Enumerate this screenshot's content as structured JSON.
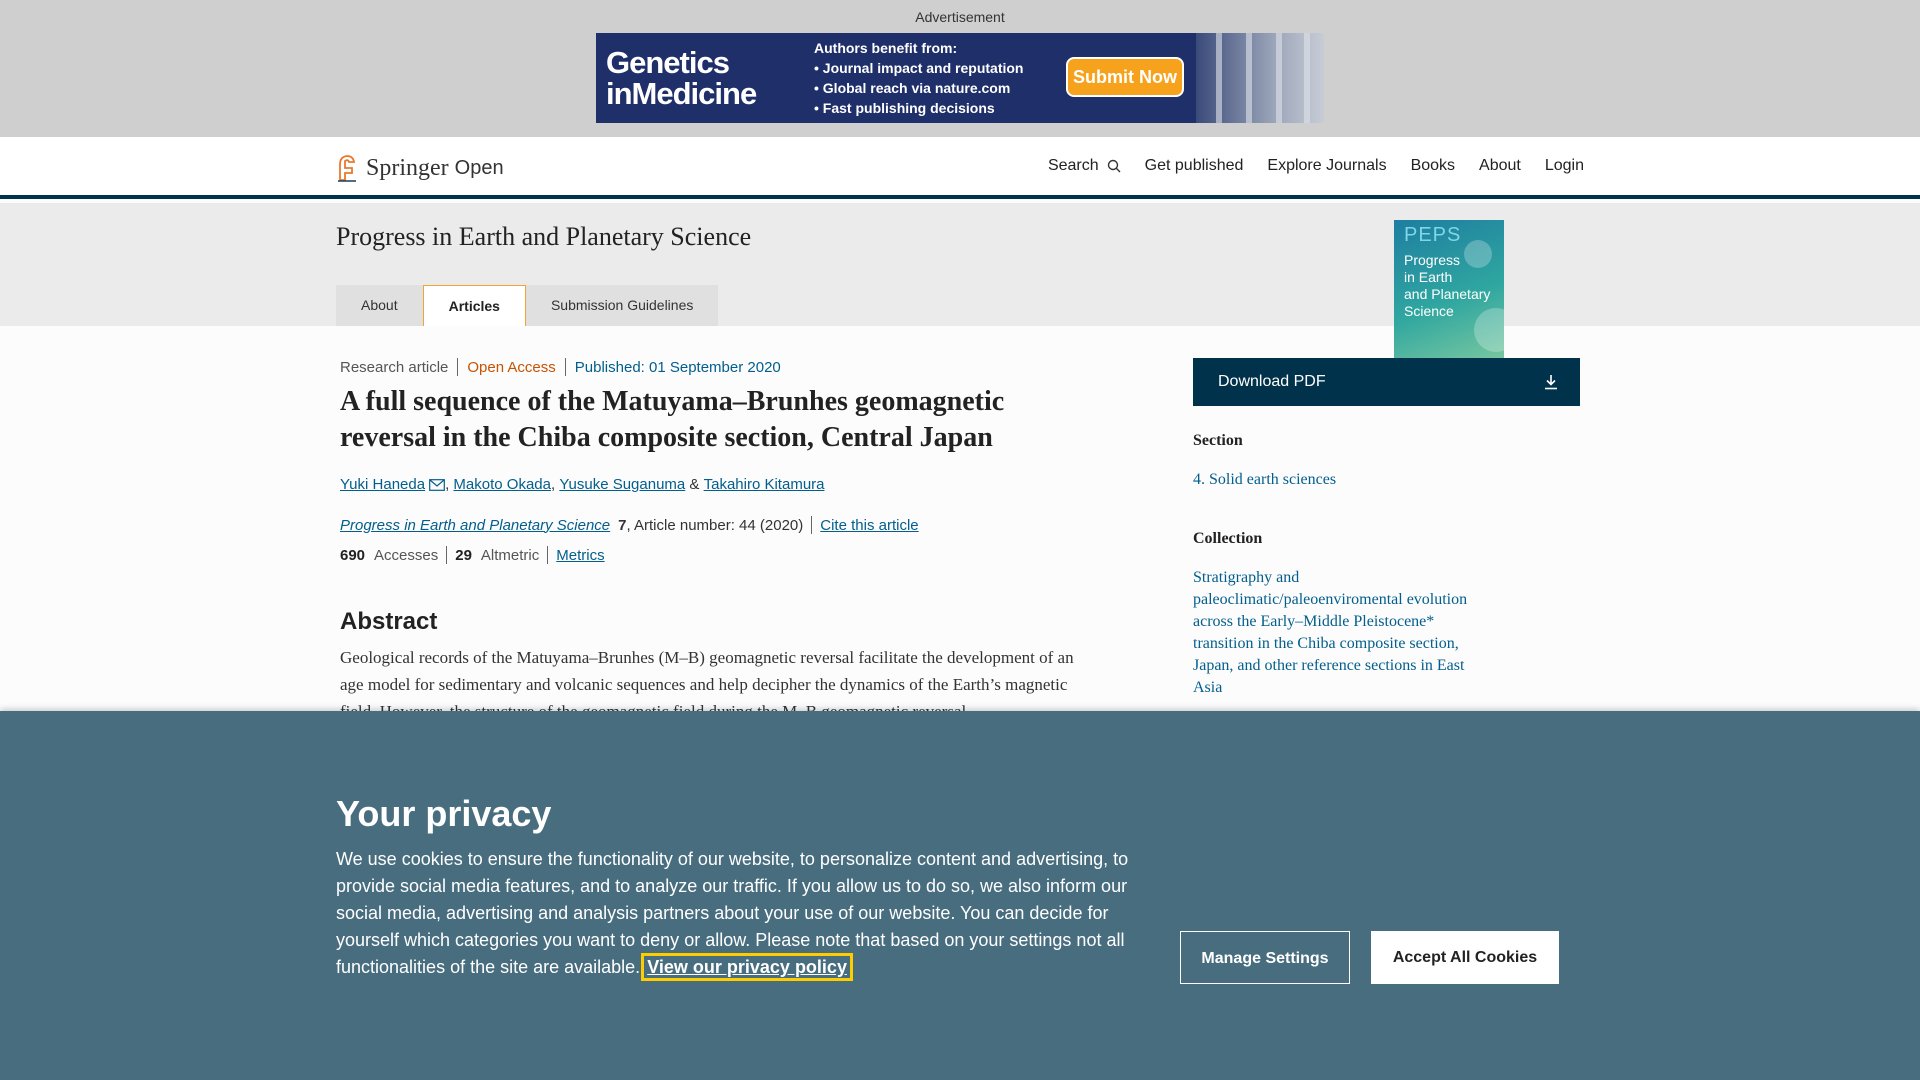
{
  "ad": {
    "label": "Advertisement",
    "brand_line1": "Genetics",
    "brand_line2": "inMedicine",
    "benefits_title": "Authors benefit from:",
    "benefits": [
      "• Journal impact and reputation",
      "• Global reach via nature.com",
      "• Fast publishing decisions"
    ],
    "cta": "Submit Now"
  },
  "header": {
    "logo_springer": "Springer",
    "logo_open": "Open",
    "nav": [
      "Search",
      "Get published",
      "Explore Journals",
      "Books",
      "About",
      "Login"
    ]
  },
  "journal": {
    "title": "Progress in Earth and Planetary Science",
    "tabs": [
      {
        "label": "About",
        "active": false
      },
      {
        "label": "Articles",
        "active": true
      },
      {
        "label": "Submission Guidelines",
        "active": false
      }
    ],
    "cover": {
      "acronym": "PEPS",
      "title_lines": [
        "Progress",
        "in Earth",
        "and Planetary",
        "Science"
      ]
    }
  },
  "article": {
    "type": "Research article",
    "access": "Open Access",
    "published": "Published: 01 September 2020",
    "title": "A full sequence of the Matuyama–Brunhes geomagnetic reversal in the Chiba composite section, Central Japan",
    "authors": [
      "Yuki Haneda",
      "Makoto Okada",
      "Yusuke Suganuma",
      "Takahiro Kitamura"
    ],
    "journal_name": "Progress in Earth and Planetary Science",
    "volume": "7",
    "article_number": ", Article number: 44 (2020)",
    "cite": "Cite this article",
    "accesses_value": "690",
    "accesses_label": "Accesses",
    "altmetric_value": "29",
    "altmetric_label": "Altmetric",
    "metrics_link": "Metrics",
    "abstract_heading": "Abstract",
    "abstract_text": "Geological records of the Matuyama–Brunhes (M–B) geomagnetic reversal facilitate the development of an age model for sedimentary and volcanic sequences and help decipher the dynamics of the Earth’s magnetic field. However, the structure of the geomagnetic field during the M–B geomagnetic reversal"
  },
  "sidebar": {
    "download": "Download PDF",
    "section_heading": "Section",
    "section_link": "4. Solid earth sciences",
    "collection_heading": "Collection",
    "collection_lines": [
      "Stratigraphy and",
      "paleoclimatic/paleoenviromental evolution",
      "across the Early–Middle Pleistocene*",
      "transition in the Chiba composite section,",
      "Japan, and other reference sections in East",
      "Asia"
    ]
  },
  "cookie": {
    "heading": "Your privacy",
    "text": "We use cookies to ensure the functionality of our website, to personalize content and advertising, to provide social media features, and to analyze our traffic. If you allow us to do so, we also inform our social media, advertising and analysis partners about your use of our website. You can decide for yourself which categories you want to deny or allow. Please note that based on your settings not all functionalities of the site are available.",
    "policy_link": "View our privacy policy",
    "manage": "Manage Settings",
    "accept": "Accept All Cookies"
  }
}
